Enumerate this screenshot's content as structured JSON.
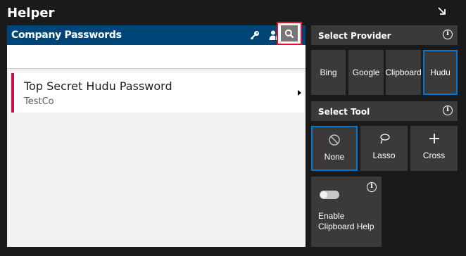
{
  "app": {
    "title": "Helper"
  },
  "left_panel": {
    "title": "Company Passwords",
    "search": {
      "value": "",
      "placeholder": ""
    },
    "results": [
      {
        "title": "Top Secret Hudu Password",
        "subtitle": "TestCo"
      }
    ]
  },
  "provider": {
    "title": "Select Provider",
    "options": [
      "Bing",
      "Google",
      "Clipboard",
      "Hudu"
    ],
    "selected": "Hudu"
  },
  "tool": {
    "title": "Select Tool",
    "options": [
      {
        "label": "None",
        "icon": "prohibited-icon"
      },
      {
        "label": "Lasso",
        "icon": "lasso-icon"
      },
      {
        "label": "Cross",
        "icon": "plus-icon"
      }
    ],
    "selected": "None"
  },
  "clipboard_help": {
    "label": "Enable Clipboard Help",
    "enabled": false
  },
  "colors": {
    "background": "#1a1a1a",
    "header_blue": "#004578",
    "accent_blue": "#0078d4",
    "card_accent": "#c5134d",
    "search_highlight": "#e81123",
    "tile": "#3b3a39"
  }
}
